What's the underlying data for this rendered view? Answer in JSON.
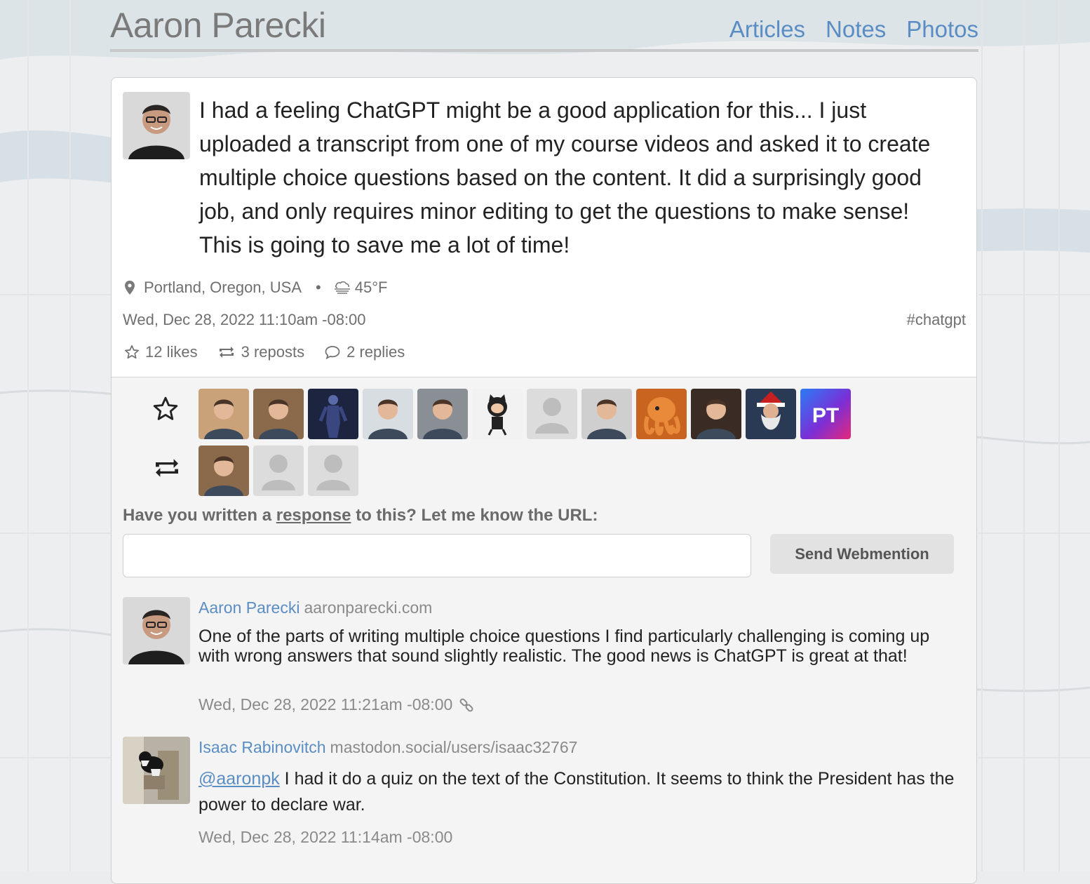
{
  "site": {
    "title": "Aaron Parecki",
    "nav": [
      "Articles",
      "Notes",
      "Photos"
    ]
  },
  "post": {
    "text": "I had a feeling ChatGPT might be a good application for this... I just uploaded a transcript from one of my course videos and asked it to create multiple choice questions based on the content. It did a surprisingly good job, and only requires minor editing to get the questions to make sense! This is going to save me a lot of time!",
    "location": "Portland, Oregon, USA",
    "separator": "•",
    "weather": "45°F",
    "date": "Wed, Dec 28, 2022 11:10am -08:00",
    "tag": "#chatgpt",
    "likes": "12 likes",
    "reposts": "3 reposts",
    "replies": "2 replies"
  },
  "facepile": {
    "likes": [
      {
        "icon": "person-avatar",
        "color": "#c9a27a"
      },
      {
        "icon": "person-avatar",
        "color": "#8a6a4a"
      },
      {
        "icon": "figure-avatar",
        "color": "#1c2440"
      },
      {
        "icon": "person-avatar",
        "color": "#d8dde2"
      },
      {
        "icon": "person-avatar",
        "color": "#8a8f96"
      },
      {
        "icon": "octocat-avatar",
        "color": "#f2f2f2"
      },
      {
        "icon": "default-avatar",
        "color": "#e0e0e0"
      },
      {
        "icon": "person-avatar",
        "color": "#cfcfcf"
      },
      {
        "icon": "octopus-avatar",
        "color": "#d9772a"
      },
      {
        "icon": "person-avatar",
        "color": "#3a2c24"
      },
      {
        "icon": "santa-avatar",
        "color": "#2a3a55"
      },
      {
        "icon": "pt-logo",
        "color": "#6a2fd0",
        "text": "PT"
      }
    ],
    "reposts": [
      {
        "icon": "person-avatar",
        "color": "#8a6a4a"
      },
      {
        "icon": "default-avatar",
        "color": "#e0e0e0"
      },
      {
        "icon": "default-avatar",
        "color": "#e0e0e0"
      }
    ]
  },
  "webmention": {
    "prompt_before": "Have you written a ",
    "prompt_link": "response",
    "prompt_after": " to this? Let me know the URL:",
    "input_value": "",
    "button": "Send Webmention"
  },
  "replies": [
    {
      "name": "Aaron Parecki",
      "url": "aaronparecki.com",
      "text": "One of the parts of writing multiple choice questions I find particularly challenging is coming up with wrong answers that sound slightly realistic. The good news is ChatGPT is great at that!",
      "date": "Wed, Dec 28, 2022 11:21am -08:00"
    },
    {
      "name": "Isaac Rabinovitch",
      "url": "mastodon.social/users/isaac32767",
      "mention": "@aaronpk",
      "text": " I had it do a quiz on the text of the Constitution. It seems to think the President has the power to declare war.",
      "date": "Wed, Dec 28, 2022 11:14am -08:00"
    }
  ]
}
